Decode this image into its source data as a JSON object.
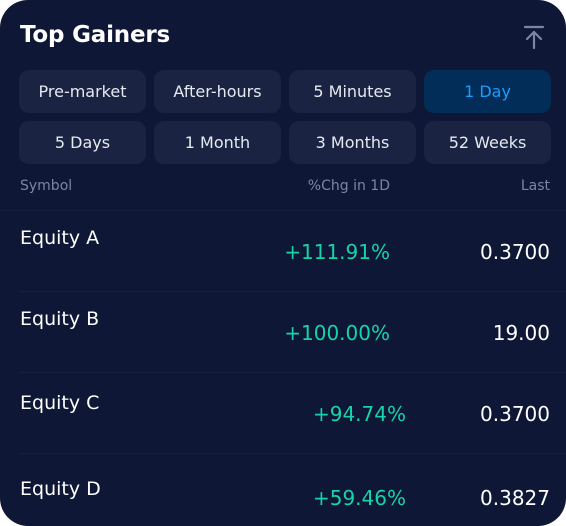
{
  "header": {
    "title": "Top Gainers",
    "scroll_top_icon": "arrow-up-to-line-icon"
  },
  "filters": [
    {
      "label": "Pre-market",
      "active": false
    },
    {
      "label": "After-hours",
      "active": false
    },
    {
      "label": "5 Minutes",
      "active": false
    },
    {
      "label": "1 Day",
      "active": true
    },
    {
      "label": "5 Days",
      "active": false
    },
    {
      "label": "1 Month",
      "active": false
    },
    {
      "label": "3 Months",
      "active": false
    },
    {
      "label": "52 Weeks",
      "active": false
    }
  ],
  "table": {
    "columns": {
      "symbol": "Symbol",
      "change": "%Chg in 1D",
      "last": "Last"
    },
    "rows": [
      {
        "symbol": "Equity A",
        "change": "+111.91%",
        "last": "0.3700"
      },
      {
        "symbol": "Equity B",
        "change": "+100.00%",
        "last": "19.00"
      },
      {
        "symbol": "Equity C",
        "change": "+94.74%",
        "last": "0.3700"
      },
      {
        "symbol": "Equity D",
        "change": "+59.46%",
        "last": "0.3827"
      }
    ]
  },
  "colors": {
    "background": "#0e1735",
    "button_bg": "#1a2442",
    "active_bg": "#022d58",
    "active_text": "#1a9dff",
    "gain": "#17d3a9",
    "muted": "#7d86a0"
  }
}
